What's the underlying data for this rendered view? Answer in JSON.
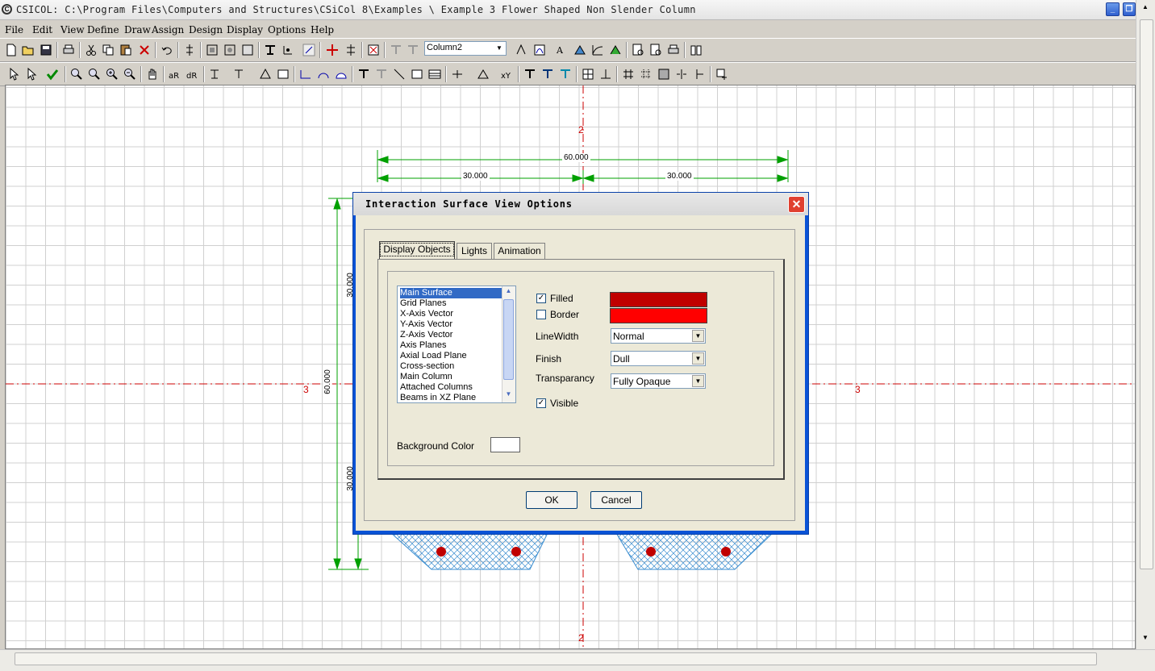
{
  "window": {
    "title": "CSICOL: C:\\Program Files\\Computers and Structures\\CSiCol 8\\Examples \\ Example 3 Flower Shaped Non Slender Column"
  },
  "menu": [
    "File",
    "Edit",
    "View",
    "Define",
    "Draw",
    "Assign",
    "Design",
    "Display",
    "Options",
    "Help"
  ],
  "toolbar": {
    "column_selector": "Column2"
  },
  "drawing": {
    "axis_top": "2",
    "axis_bottom": "2",
    "axis_left": "3",
    "axis_right": "3",
    "dim_total_horizontal": "60.000",
    "dim_left_half": "30.000",
    "dim_right_half": "30.000",
    "dim_total_vertical": "60.000",
    "dim_upper_half": "30.000",
    "dim_lower_half": "30.000"
  },
  "dialog": {
    "title": "Interaction Surface View Options",
    "tabs": [
      "Display Objects",
      "Lights",
      "Animation"
    ],
    "active_tab": "Display Objects",
    "objects": [
      "Main Surface",
      "Grid Planes",
      "X-Axis Vector",
      "Y-Axis Vector",
      "Z-Axis Vector",
      "Axis Planes",
      "Axial Load Plane",
      "Cross-section",
      "Main Column",
      "Attached Columns",
      "Beams in XZ Plane"
    ],
    "selected_object": "Main Surface",
    "filled_label": "Filled",
    "filled_checked": true,
    "filled_color": "#c00000",
    "border_label": "Border",
    "border_checked": false,
    "border_color": "#ff0000",
    "linewidth_label": "LineWidth",
    "linewidth_value": "Normal",
    "finish_label": "Finish",
    "finish_value": "Dull",
    "transparency_label": "Transparancy",
    "transparency_value": "Fully Opaque",
    "visible_label": "Visible",
    "visible_checked": true,
    "background_label": "Background Color",
    "background_color": "#ffffff",
    "ok_label": "OK",
    "cancel_label": "Cancel"
  }
}
